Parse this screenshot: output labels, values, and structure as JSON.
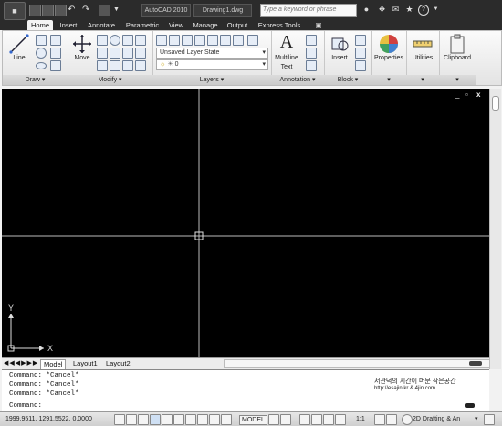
{
  "titlebar": {
    "app_title": "AutoCAD 2010",
    "file_title": "Drawing1.dwg",
    "search_placeholder": "Type a keyword or phrase"
  },
  "tabs": [
    "Home",
    "Insert",
    "Annotate",
    "Parametric",
    "View",
    "Manage",
    "Output",
    "Express Tools"
  ],
  "ribbon": {
    "draw": {
      "line_label": "Line",
      "panel_label": "Draw"
    },
    "modify": {
      "move_label": "Move",
      "panel_label": "Modify"
    },
    "layers": {
      "layer_state": "Unsaved Layer State",
      "layer_current": "0",
      "panel_label": "Layers"
    },
    "annotation": {
      "text_label_1": "Multiline",
      "text_label_2": "Text",
      "panel_label": "Annotation"
    },
    "block": {
      "insert_label": "Insert",
      "panel_label": "Block"
    },
    "properties_label": "Properties",
    "utilities_label": "Utilities",
    "clipboard_label": "Clipboard"
  },
  "viewport": {
    "axis_x": "X",
    "axis_y": "Y",
    "window_controls": [
      "_",
      "▫",
      "x"
    ]
  },
  "layout_tabs": [
    "Model",
    "Layout1",
    "Layout2"
  ],
  "command": {
    "history": [
      "Command: *Cancel*",
      "Command: *Cancel*",
      "Command: *Cancel*"
    ],
    "prompt": "Command:"
  },
  "watermark": {
    "line1": "서관덕의 시간이 머문 작은공간",
    "line2": "http://esajin.kr & 4jin.com"
  },
  "status": {
    "coordinates": "1999.9511, 1291.5522, 0.0000",
    "model_label": "MODEL",
    "scale": "1:1",
    "workspace": "2D Drafting & An"
  }
}
